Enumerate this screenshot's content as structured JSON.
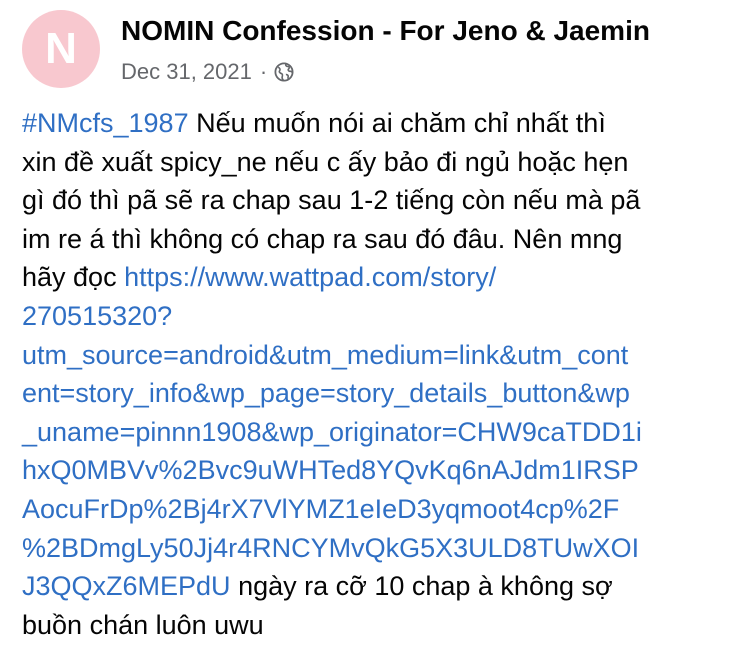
{
  "page": {
    "avatar_letter": "N",
    "title": "NOMIN Confession - For Jeno & Jaemin",
    "date": "Dec 31, 2021",
    "separator": "·",
    "privacy_icon": "globe-icon"
  },
  "post": {
    "hashtag": "#NMcfs_1987",
    "line1": " Nếu muốn nói ai chăm chỉ nhất thì",
    "line2": "xin đề xuất  spicy_ne nếu c ấy bảo đi ngủ hoặc hẹn",
    "line3": "gì đó thì pã sẽ ra chap sau 1-2 tiếng còn nếu mà pã",
    "line4": "im re á thì không có chap ra sau đó đâu. Nên mng",
    "line5_text": "hãy đọc ",
    "url_lines": [
      "https://www.wattpad.com/story/",
      "270515320?",
      "utm_source=android&utm_medium=link&utm_cont",
      "ent=story_info&wp_page=story_details_button&wp",
      "_uname=pinnn1908&wp_originator=CHW9caTDD1i",
      "hxQ0MBVv%2Bvc9uWHTed8YQvKq6nAJdm1IRSP",
      "AocuFrDp%2Bj4rX7VlYMZ1eIeD3yqmoot4cp%2F",
      "%2BDmgLy50Jj4r4RNCYMvQkG5X3ULD8TUwXOI",
      "J3QQxZ6MEPdU"
    ],
    "line_last_after_url": " ngày ra cỡ 10 chap à không sợ",
    "line_final": "buồn chán luôn uwu"
  },
  "colors": {
    "link": "#2f6fc4",
    "text": "#050505",
    "meta": "#65676b",
    "avatar_bg": "#f8c8cf"
  }
}
